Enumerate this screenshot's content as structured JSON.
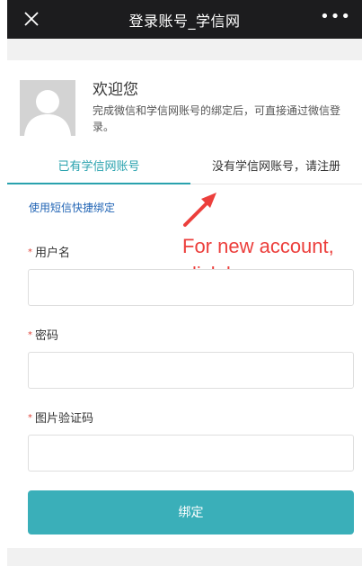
{
  "titlebar": {
    "title": "登录账号_学信网",
    "more": "•••"
  },
  "profile": {
    "welcome": "欢迎您",
    "description": "完成微信和学信网账号的绑定后，可直接通过微信登录。"
  },
  "tabs": {
    "existing": "已有学信网账号",
    "register": "没有学信网账号，请注册"
  },
  "sms_link": "使用短信快捷绑定",
  "annotation": {
    "line1": "For new account,",
    "line2": "click here"
  },
  "form": {
    "required_mark": "*",
    "username_label": "用户名",
    "password_label": "密码",
    "captcha_label": "图片验证码",
    "submit": "绑定"
  },
  "colors": {
    "accent": "#29a2ae",
    "button": "#3aafb9",
    "link": "#2265b5",
    "annotation": "#ec3f3c"
  }
}
